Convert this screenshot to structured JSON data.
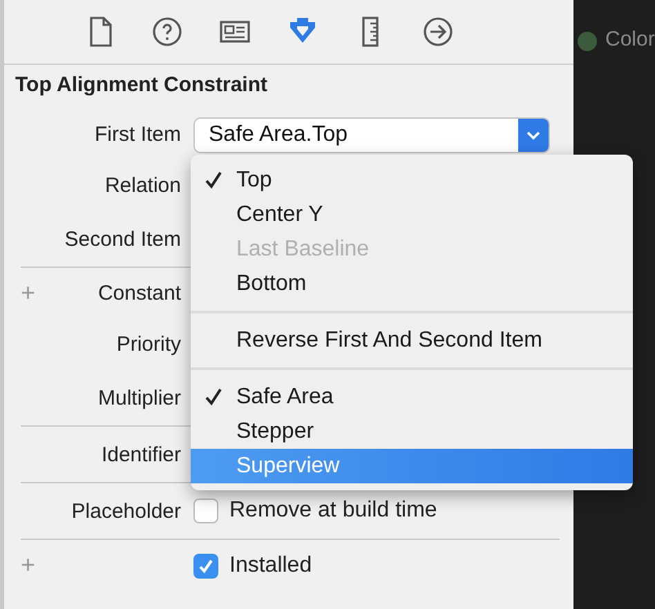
{
  "toolbar": {
    "tabs": [
      {
        "selected": false
      },
      {
        "selected": false
      },
      {
        "selected": false
      },
      {
        "selected": true
      },
      {
        "selected": false
      },
      {
        "selected": false
      }
    ]
  },
  "side_panel": {
    "label": "Color"
  },
  "section_title": "Top Alignment Constraint",
  "rows": [
    {
      "label": "First Item",
      "kind": "popup",
      "value": "Safe Area.Top",
      "divider": false
    },
    {
      "label": "Relation",
      "kind": "covered",
      "divider": false
    },
    {
      "label": "Second Item",
      "kind": "covered",
      "divider": true
    },
    {
      "label": "Constant",
      "kind": "covered",
      "plus": "+",
      "divider": false
    },
    {
      "label": "Priority",
      "kind": "covered",
      "divider": false
    },
    {
      "label": "Multiplier",
      "kind": "covered",
      "divider": true
    },
    {
      "label": "Identifier",
      "kind": "covered",
      "divider": true
    },
    {
      "label": "Placeholder",
      "kind": "checkbox",
      "text": "Remove at build time",
      "checked": false,
      "divider": true
    },
    {
      "kind": "checkbox",
      "text": "Installed",
      "checked": true,
      "plus": "+",
      "divider": false
    }
  ],
  "menu": {
    "sections": [
      [
        {
          "label": "Top",
          "checked": true,
          "disabled": false,
          "selected": false
        },
        {
          "label": "Center Y",
          "checked": false,
          "disabled": false,
          "selected": false
        },
        {
          "label": "Last Baseline",
          "checked": false,
          "disabled": true,
          "selected": false
        },
        {
          "label": "Bottom",
          "checked": false,
          "disabled": false,
          "selected": false
        }
      ],
      [
        {
          "label": "Reverse First And Second Item",
          "checked": false,
          "disabled": false,
          "selected": false
        }
      ],
      [
        {
          "label": "Safe Area",
          "checked": true,
          "disabled": false,
          "selected": false
        },
        {
          "label": "Stepper",
          "checked": false,
          "disabled": false,
          "selected": false
        },
        {
          "label": "Superview",
          "checked": false,
          "disabled": false,
          "selected": true
        }
      ]
    ]
  }
}
